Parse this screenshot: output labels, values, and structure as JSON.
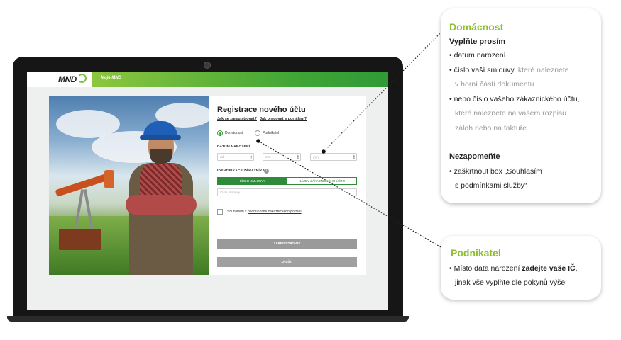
{
  "app": {
    "logo": "MND",
    "nav_title": "Moje MND"
  },
  "form": {
    "title": "Registrace nového účtu",
    "link_how_register": "Jak se zaregistrovat?",
    "link_how_portal": "Jak pracovat s portálem?",
    "customer_types": [
      {
        "label": "Domácnost",
        "selected": true
      },
      {
        "label": "Podnikatel",
        "selected": false
      }
    ],
    "birthdate_label": "DATUM NAROZENÍ",
    "birthdate_fields": {
      "day": "dd",
      "month": "mm",
      "year": "yyyy"
    },
    "identification_label": "IDENTIFIKACE ZÁKAZNÍKA",
    "id_tabs": [
      "ČÍSLO SMLOUVY",
      "NÁZEV ZÁKAZNICKÉHO ÚČTU"
    ],
    "contract_placeholder": "Číslo smlouvy",
    "consent_text": "Souhlasím s",
    "consent_link": "podmínkami zákaznického portálu",
    "register_button": "ZAREGISTROVAT",
    "cancel_button": "ZRUŠIT"
  },
  "callout_household": {
    "title": "Domácnost",
    "subtitle": "Vyplňte prosím",
    "bullet1": "datum narození",
    "bullet2_main": "číslo vaší smlouvy,",
    "bullet2_grey_a": "které naleznete",
    "bullet2_grey_b": "v horní části dokumentu",
    "bullet3_main": "nebo číslo vašeho zákaznického účtu,",
    "bullet3_grey_a": "které naleznete na vašem rozpisu",
    "bullet3_grey_b": "záloh nebo na faktuře",
    "subtitle2": "Nezapomeňte",
    "bullet4_a": "zaškrtnout box „Souhlasím",
    "bullet4_b": "s podmínkami služby“"
  },
  "callout_business": {
    "title": "Podnikatel",
    "line1_a": "Místo data narození",
    "line1_b": "zadejte vaše IČ",
    "line1_c": ",",
    "line2": "jinak vše vyplňte dle pokynů výše"
  },
  "colors": {
    "brand_green": "#3fa535",
    "callout_title": "#8cbf2d",
    "toggle_green": "#2e8b3a"
  }
}
